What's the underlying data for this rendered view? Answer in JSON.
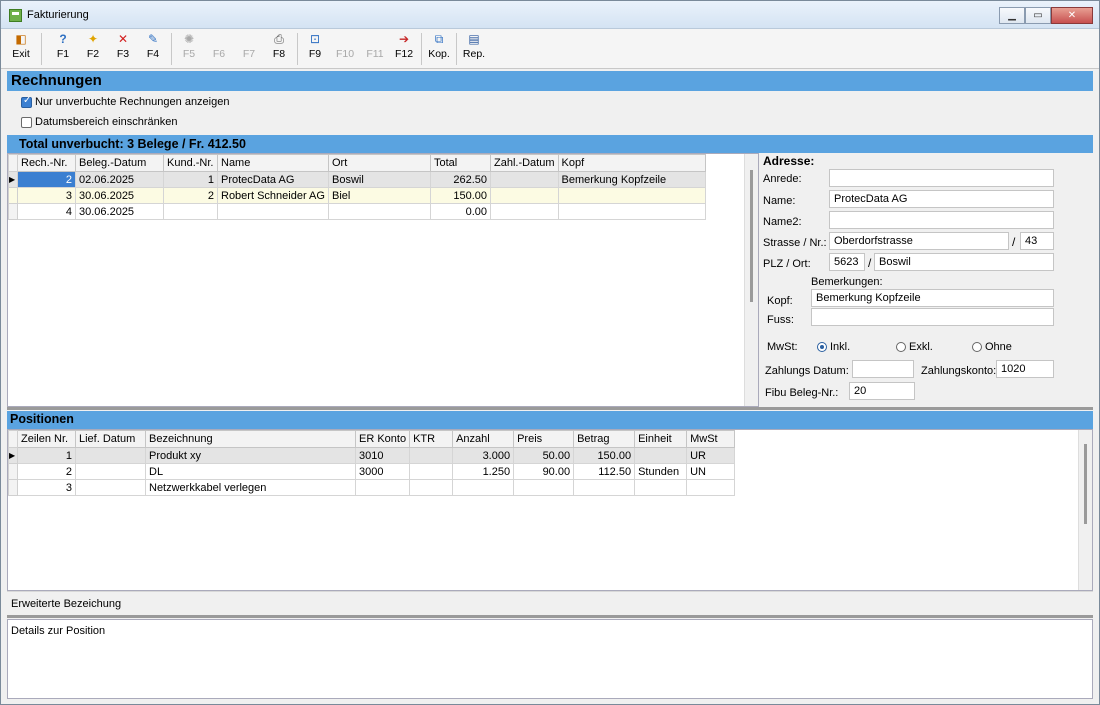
{
  "window": {
    "title": "Fakturierung"
  },
  "toolbar": {
    "buttons": [
      {
        "label": "Exit",
        "icon": "exit-icon",
        "glyph": "◧"
      },
      {
        "label": "F1",
        "icon": "help-icon",
        "glyph": "?"
      },
      {
        "label": "F2",
        "icon": "new-icon",
        "glyph": "✦"
      },
      {
        "label": "F3",
        "icon": "delete-icon",
        "glyph": "✕"
      },
      {
        "label": "F4",
        "icon": "edit-icon",
        "glyph": "✎"
      },
      {
        "label": "F5",
        "icon": "lightbulb-icon",
        "glyph": "✺"
      },
      {
        "label": "F6",
        "icon": "",
        "glyph": ""
      },
      {
        "label": "F7",
        "icon": "",
        "glyph": ""
      },
      {
        "label": "F8",
        "icon": "print-icon",
        "glyph": "⎙"
      },
      {
        "label": "F9",
        "icon": "search-icon",
        "glyph": "⊡"
      },
      {
        "label": "F10",
        "icon": "",
        "glyph": ""
      },
      {
        "label": "F11",
        "icon": "",
        "glyph": ""
      },
      {
        "label": "F12",
        "icon": "export-icon",
        "glyph": "➔"
      },
      {
        "label": "Kop.",
        "icon": "copy-icon",
        "glyph": "⧉"
      },
      {
        "label": "Rep.",
        "icon": "report-icon",
        "glyph": "▤"
      }
    ]
  },
  "rechnungen": {
    "title": "Rechnungen",
    "filter_unbooked": "Nur unverbuchte Rechnungen anzeigen",
    "filter_date": "Datumsbereich einschränken",
    "total": "Total unverbucht: 3 Belege / Fr. 412.50",
    "columns": [
      "Rech.-Nr.",
      "Beleg.-Datum",
      "Kund.-Nr.",
      "Name",
      "Ort",
      "Total",
      "Zahl.-Datum",
      "Kopf"
    ],
    "rows": [
      {
        "nr": "2",
        "datum": "02.06.2025",
        "kund": "1",
        "name": "ProtecData AG",
        "ort": "Boswil",
        "total": "262.50",
        "zahl": "",
        "kopf": "Bemerkung Kopfzeile"
      },
      {
        "nr": "3",
        "datum": "30.06.2025",
        "kund": "2",
        "name": "Robert Schneider AG",
        "ort": "Biel",
        "total": "150.00",
        "zahl": "",
        "kopf": ""
      },
      {
        "nr": "4",
        "datum": "30.06.2025",
        "kund": "",
        "name": "",
        "ort": "",
        "total": "0.00",
        "zahl": "",
        "kopf": ""
      }
    ]
  },
  "adresse": {
    "title": "Adresse:",
    "anrede_label": "Anrede:",
    "anrede": "",
    "name_label": "Name:",
    "name": "ProtecData AG",
    "name2_label": "Name2:",
    "name2": "",
    "strasse_label": "Strasse / Nr.:",
    "strasse": "Oberdorfstrasse",
    "nr_sep": "/",
    "nr": "43",
    "plz_label": "PLZ / Ort:",
    "plz": "5623",
    "ort_sep": "/",
    "ort": "Boswil",
    "bemerkungen_label": "Bemerkungen:",
    "kopf_label": "Kopf:",
    "kopf": "Bemerkung Kopfzeile",
    "fuss_label": "Fuss:",
    "fuss": "",
    "mwst_label": "MwSt:",
    "mwst_options": [
      "Inkl.",
      "Exkl.",
      "Ohne"
    ],
    "mwst_selected": "Inkl.",
    "zahlungsdatum_label": "Zahlungs Datum:",
    "zahlungsdatum": "",
    "zahlungskonto_label": "Zahlungskonto:",
    "zahlungskonto": "1020",
    "fibu_label": "Fibu Beleg-Nr.:",
    "fibu": "20"
  },
  "positionen": {
    "title": "Positionen",
    "columns": [
      "Zeilen Nr.",
      "Lief. Datum",
      "Bezeichnung",
      "ER Konto",
      "KTR",
      "Anzahl",
      "Preis",
      "Betrag",
      "Einheit",
      "MwSt"
    ],
    "rows": [
      {
        "zeile": "1",
        "lief": "",
        "bez": "Produkt xy",
        "konto": "3010",
        "ktr": "",
        "anzahl": "3.000",
        "preis": "50.00",
        "betrag": "150.00",
        "einheit": "",
        "mwst": "UR"
      },
      {
        "zeile": "2",
        "lief": "",
        "bez": "DL",
        "konto": "3000",
        "ktr": "",
        "anzahl": "1.250",
        "preis": "90.00",
        "betrag": "112.50",
        "einheit": "Stunden",
        "mwst": "UN"
      },
      {
        "zeile": "3",
        "lief": "",
        "bez": "Netzwerkkabel verlegen",
        "konto": "",
        "ktr": "",
        "anzahl": "",
        "preis": "",
        "betrag": "",
        "einheit": "",
        "mwst": ""
      }
    ],
    "erweiterte_label": "Erweiterte Bezeichung",
    "details_label": "Details zur Position"
  },
  "colors": {
    "section_header": "#5aa3e0",
    "selection": "#3b7fd1",
    "alt_row": "#fcfbe3"
  }
}
